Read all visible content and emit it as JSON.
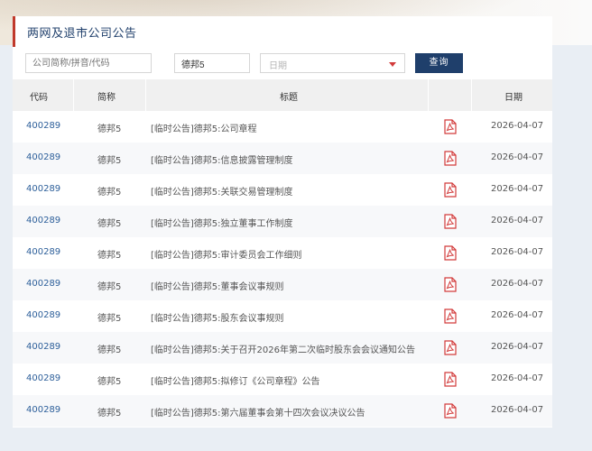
{
  "page": {
    "section_title": "两网及退市公司公告"
  },
  "search": {
    "company_placeholder": "公司简称/拼音/代码",
    "keyword_value": "德邦5",
    "date_placeholder": "日期",
    "query_label": "查询"
  },
  "table": {
    "headers": {
      "code": "代码",
      "abbr": "简称",
      "title": "标题",
      "date": "日期"
    },
    "rows": [
      {
        "code": "400289",
        "abbr": "德邦5",
        "title": "[临时公告]德邦5:公司章程",
        "date": "2026-04-07",
        "icon": "pdf-icon"
      },
      {
        "code": "400289",
        "abbr": "德邦5",
        "title": "[临时公告]德邦5:信息披露管理制度",
        "date": "2026-04-07",
        "icon": "pdf-icon"
      },
      {
        "code": "400289",
        "abbr": "德邦5",
        "title": "[临时公告]德邦5:关联交易管理制度",
        "date": "2026-04-07",
        "icon": "pdf-icon"
      },
      {
        "code": "400289",
        "abbr": "德邦5",
        "title": "[临时公告]德邦5:独立董事工作制度",
        "date": "2026-04-07",
        "icon": "pdf-icon"
      },
      {
        "code": "400289",
        "abbr": "德邦5",
        "title": "[临时公告]德邦5:审计委员会工作细则",
        "date": "2026-04-07",
        "icon": "pdf-icon"
      },
      {
        "code": "400289",
        "abbr": "德邦5",
        "title": "[临时公告]德邦5:董事会议事规则",
        "date": "2026-04-07",
        "icon": "pdf-icon"
      },
      {
        "code": "400289",
        "abbr": "德邦5",
        "title": "[临时公告]德邦5:股东会议事规则",
        "date": "2026-04-07",
        "icon": "pdf-icon"
      },
      {
        "code": "400289",
        "abbr": "德邦5",
        "title": "[临时公告]德邦5:关于召开2026年第二次临时股东会会议通知公告",
        "date": "2026-04-07",
        "icon": "pdf-icon"
      },
      {
        "code": "400289",
        "abbr": "德邦5",
        "title": "[临时公告]德邦5:拟修订《公司章程》公告",
        "date": "2026-04-07",
        "icon": "pdf-icon"
      },
      {
        "code": "400289",
        "abbr": "德邦5",
        "title": "[临时公告]德邦5:第六届董事会第十四次会议决议公告",
        "date": "2026-04-07",
        "icon": "pdf-icon"
      }
    ]
  },
  "colors": {
    "accent_red": "#c0392b",
    "brand_navy": "#1f3f6b",
    "link_blue": "#2d5f9a",
    "pdf_red": "#d23b3b"
  }
}
